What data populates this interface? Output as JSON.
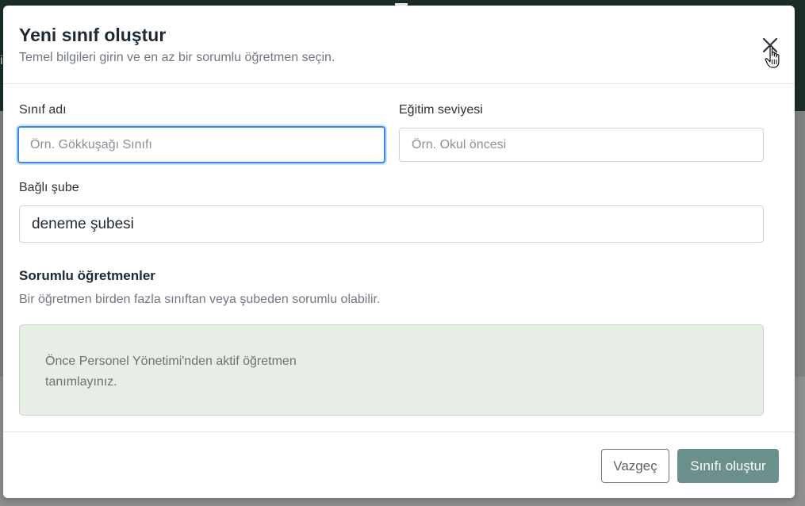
{
  "modal": {
    "title": "Yeni sınıf oluştur",
    "subtitle": "Temel bilgileri girin ve en az bir sorumlu öğretmen seçin.",
    "close_icon": "close-icon"
  },
  "form": {
    "class_name": {
      "label": "Sınıf adı",
      "value": "",
      "placeholder": "Örn. Gökkuşağı Sınıfı"
    },
    "education_level": {
      "label": "Eğitim seviyesi",
      "value": "",
      "placeholder": "Örn. Okul öncesi"
    },
    "branch": {
      "label": "Bağlı şube",
      "selected": "deneme şubesi"
    }
  },
  "teachers": {
    "heading": "Sorumlu öğretmenler",
    "help": "Bir öğretmen birden fazla sınıftan veya şubeden sorumlu olabilir.",
    "empty_message": "Önce Personel Yönetimi'nden aktif öğretmen tanımlayınız."
  },
  "footer": {
    "cancel_label": "Vazgeç",
    "submit_label": "Sınıfı oluştur"
  },
  "colors": {
    "primary_button": "#6b8f8a",
    "focus_ring": "#3a8be0",
    "info_box_bg": "#e7eee5",
    "background_topbar": "#1b2e27"
  }
}
